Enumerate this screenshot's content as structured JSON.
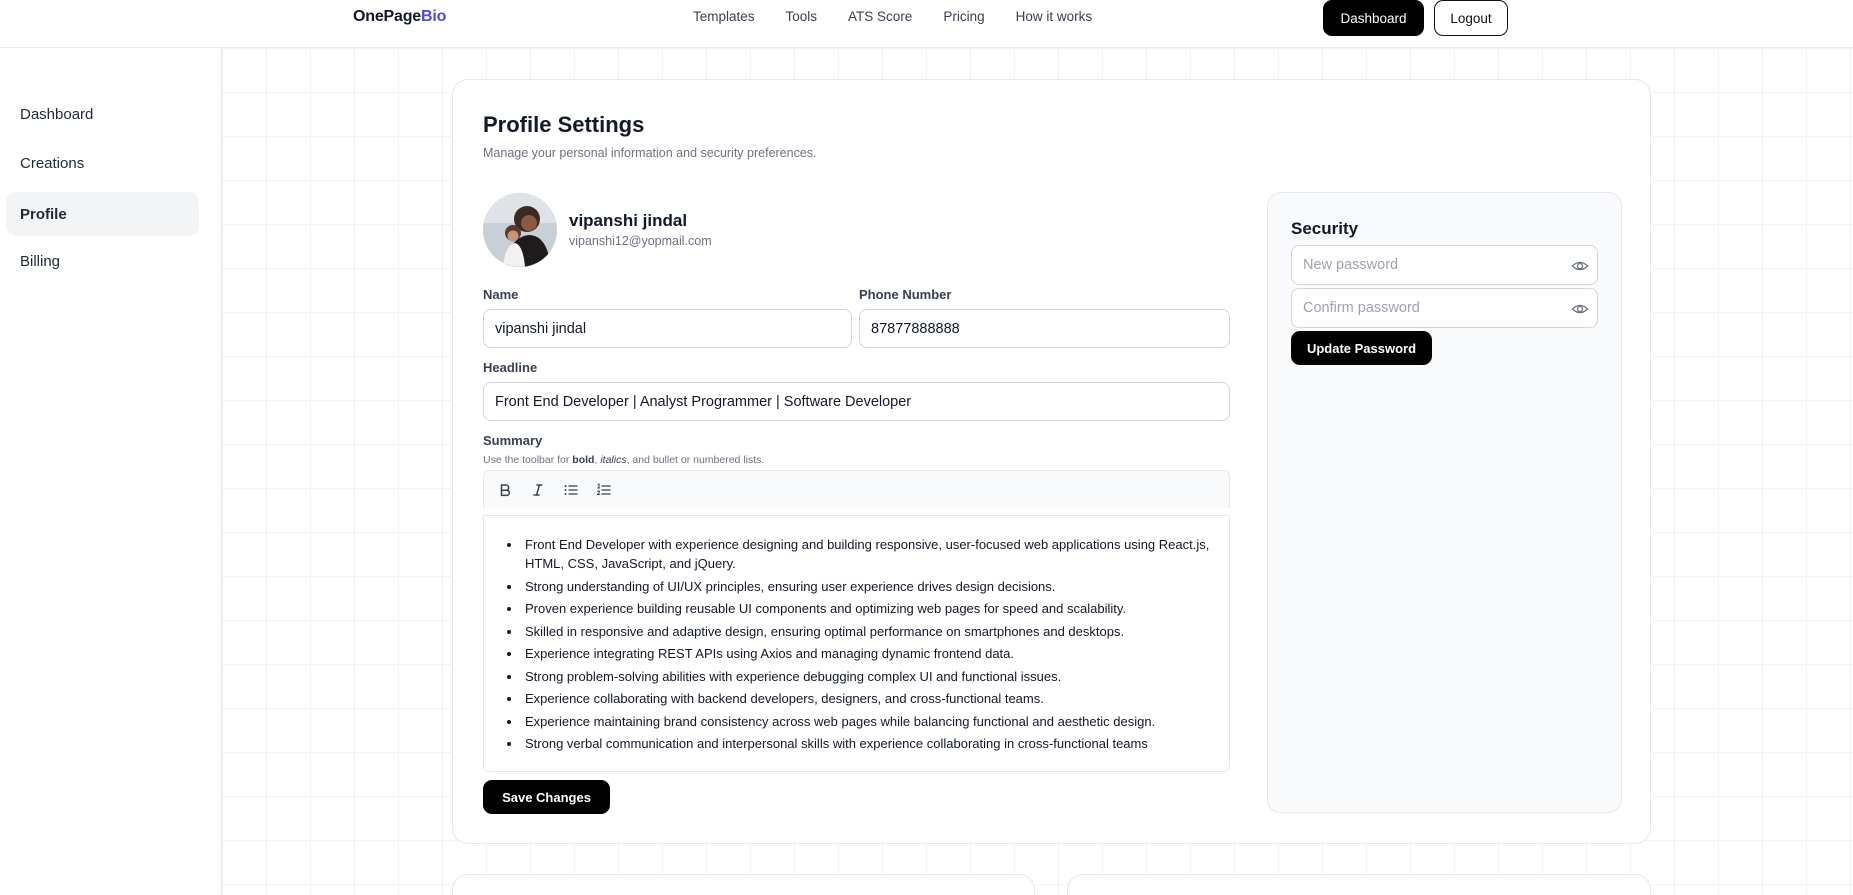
{
  "brand": {
    "part1": "OnePage",
    "part2": "Bio",
    "accent": "#4f46e5"
  },
  "nav": {
    "links": [
      "Templates",
      "Tools",
      "ATS Score",
      "Pricing",
      "How it works"
    ],
    "dashboard_label": "Dashboard",
    "logout_label": "Logout"
  },
  "sidebar": {
    "items": [
      {
        "label": "Dashboard",
        "active": false
      },
      {
        "label": "Creations",
        "active": false
      },
      {
        "label": "Profile",
        "active": true
      },
      {
        "label": "Billing",
        "active": false
      }
    ]
  },
  "page": {
    "title": "Profile Settings",
    "subtitle": "Manage your personal information and security preferences."
  },
  "profile": {
    "name": "vipanshi jindal",
    "email": "vipanshi12@yopmail.com"
  },
  "form": {
    "name_label": "Name",
    "name_value": "vipanshi jindal",
    "phone_label": "Phone Number",
    "phone_value": "87877888888",
    "headline_label": "Headline",
    "headline_value": "Front End Developer | Analyst Programmer | Software Developer",
    "summary_label": "Summary",
    "summary_hint": {
      "prefix": "Use the toolbar for ",
      "bold": "bold",
      "sep": ", ",
      "italics": "italics",
      "suffix": ", and bullet or numbered lists."
    },
    "toolbar": [
      "bold-icon",
      "italic-icon",
      "bullet-list-icon",
      "numbered-list-icon"
    ],
    "summary_items": [
      "Front End Developer with experience designing and building responsive, user-focused web applications using React.js, HTML, CSS, JavaScript, and jQuery.",
      "Strong understanding of UI/UX principles, ensuring user experience drives design decisions.",
      "Proven experience building reusable UI components and optimizing web pages for speed and scalability.",
      "Skilled in responsive and adaptive design, ensuring optimal performance on smartphones and desktops.",
      "Experience integrating REST APIs using Axios and managing dynamic frontend data.",
      "Strong problem-solving abilities with experience debugging complex UI and functional issues.",
      "Experience collaborating with backend developers, designers, and cross-functional teams.",
      "Experience maintaining brand consistency across web pages while balancing functional and aesthetic design.",
      "Strong verbal communication and interpersonal skills with experience collaborating in cross-functional teams"
    ],
    "save_label": "Save Changes"
  },
  "security": {
    "title": "Security",
    "new_password_placeholder": "New password",
    "confirm_password_placeholder": "Confirm password",
    "update_label": "Update Password"
  }
}
